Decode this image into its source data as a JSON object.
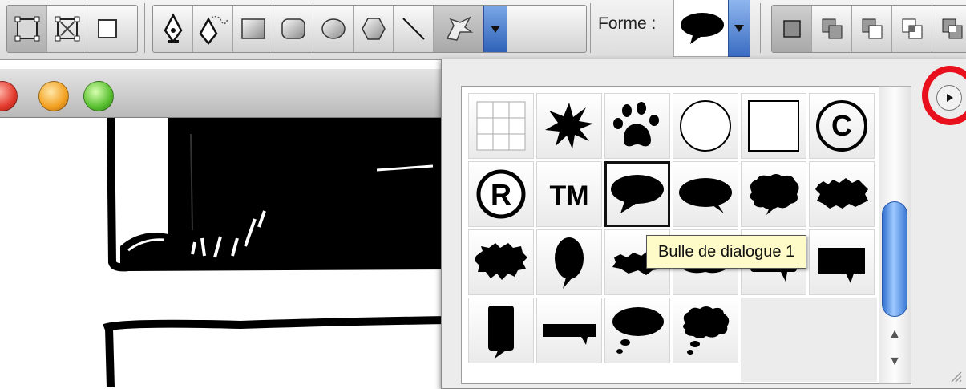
{
  "toolbar": {
    "forme_label": "Forme :",
    "mode_buttons": [
      "shape-layers-icon",
      "paths-icon",
      "fill-pixels-icon"
    ],
    "tool_buttons": [
      "pen-icon",
      "freeform-pen-icon",
      "rectangle-icon",
      "rounded-rectangle-icon",
      "ellipse-icon",
      "polygon-icon",
      "line-icon",
      "custom-shape-icon"
    ],
    "combine_buttons": [
      "new-layer-icon",
      "add-area-icon",
      "subtract-area-icon",
      "intersect-area-icon",
      "exclude-area-icon"
    ]
  },
  "shape_picker": {
    "tooltip": "Bulle de dialogue 1",
    "shapes": [
      [
        "grid-icon",
        "starburst-icon",
        "paw-print-icon",
        "circle-frame-icon",
        "square-frame-icon",
        "copyright-icon"
      ],
      [
        "registered-icon",
        "trademark-icon",
        "speech-bubble-1-icon",
        "speech-bubble-2-icon",
        "speech-bubble-3-icon",
        "speech-bubble-4-icon"
      ],
      [
        "speech-bubble-5-icon",
        "speech-bubble-6-icon",
        "speech-bubble-7-icon",
        "speech-bubble-8-icon",
        "speech-bubble-9-icon",
        "speech-bubble-10-icon"
      ],
      [
        "speech-bubble-11-icon",
        "speech-bubble-12-icon",
        "thought-bubble-1-icon",
        "thought-bubble-2-icon"
      ]
    ],
    "glyphs": {
      "copyright": "©",
      "registered": "R",
      "trademark": "TM"
    },
    "scroll_up_glyph": "▲",
    "scroll_down_glyph": "▼"
  },
  "colors": {
    "highlight_ring": "#e8101c",
    "accent_blue": "#2f62b8",
    "tooltip_bg": "#fffbc8"
  }
}
